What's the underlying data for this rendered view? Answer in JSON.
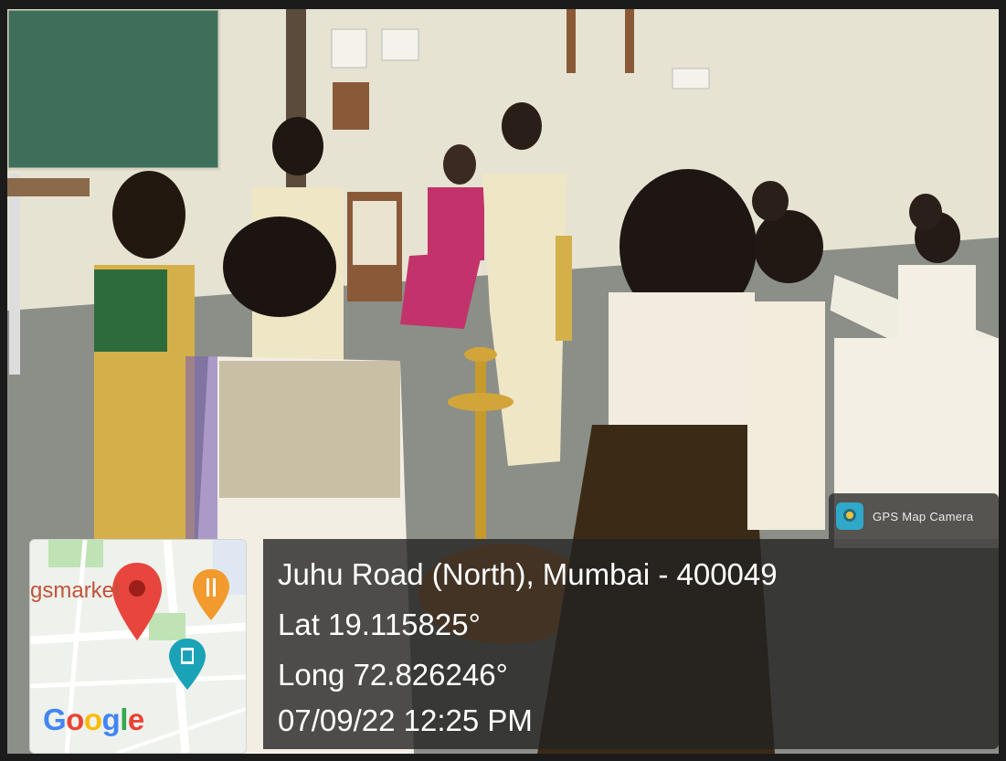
{
  "overlay": {
    "app_name": "GPS Map Camera",
    "address": "Juhu Road (North), Mumbai - 400049",
    "latitude": "Lat 19.115825°",
    "longitude": "Long 72.826246°",
    "datetime": "07/09/22 12:25 PM"
  },
  "map": {
    "place_label": "gsmarket",
    "pin_icon": "location-pin-icon",
    "restaurant_icon": "fork-knife-icon",
    "cinema_icon": "film-icon",
    "brand": {
      "G": "G",
      "o1": "o",
      "o2": "o",
      "g": "g",
      "l": "l",
      "e": "e"
    },
    "colors": {
      "pin": "#e8453c",
      "restaurant": "#f29a2e",
      "cinema": "#1aa3b7",
      "roads": "#ffffff",
      "park": "#bfe3b4"
    }
  },
  "scene": {
    "colors": {
      "wall": "#e7e3d3",
      "floor": "#8b8f88",
      "chalkboard": "#3e6f5a",
      "saree_cream": "#efe6c6",
      "saree_gold": "#d5b04a",
      "saree_pink": "#c2336b"
    }
  }
}
